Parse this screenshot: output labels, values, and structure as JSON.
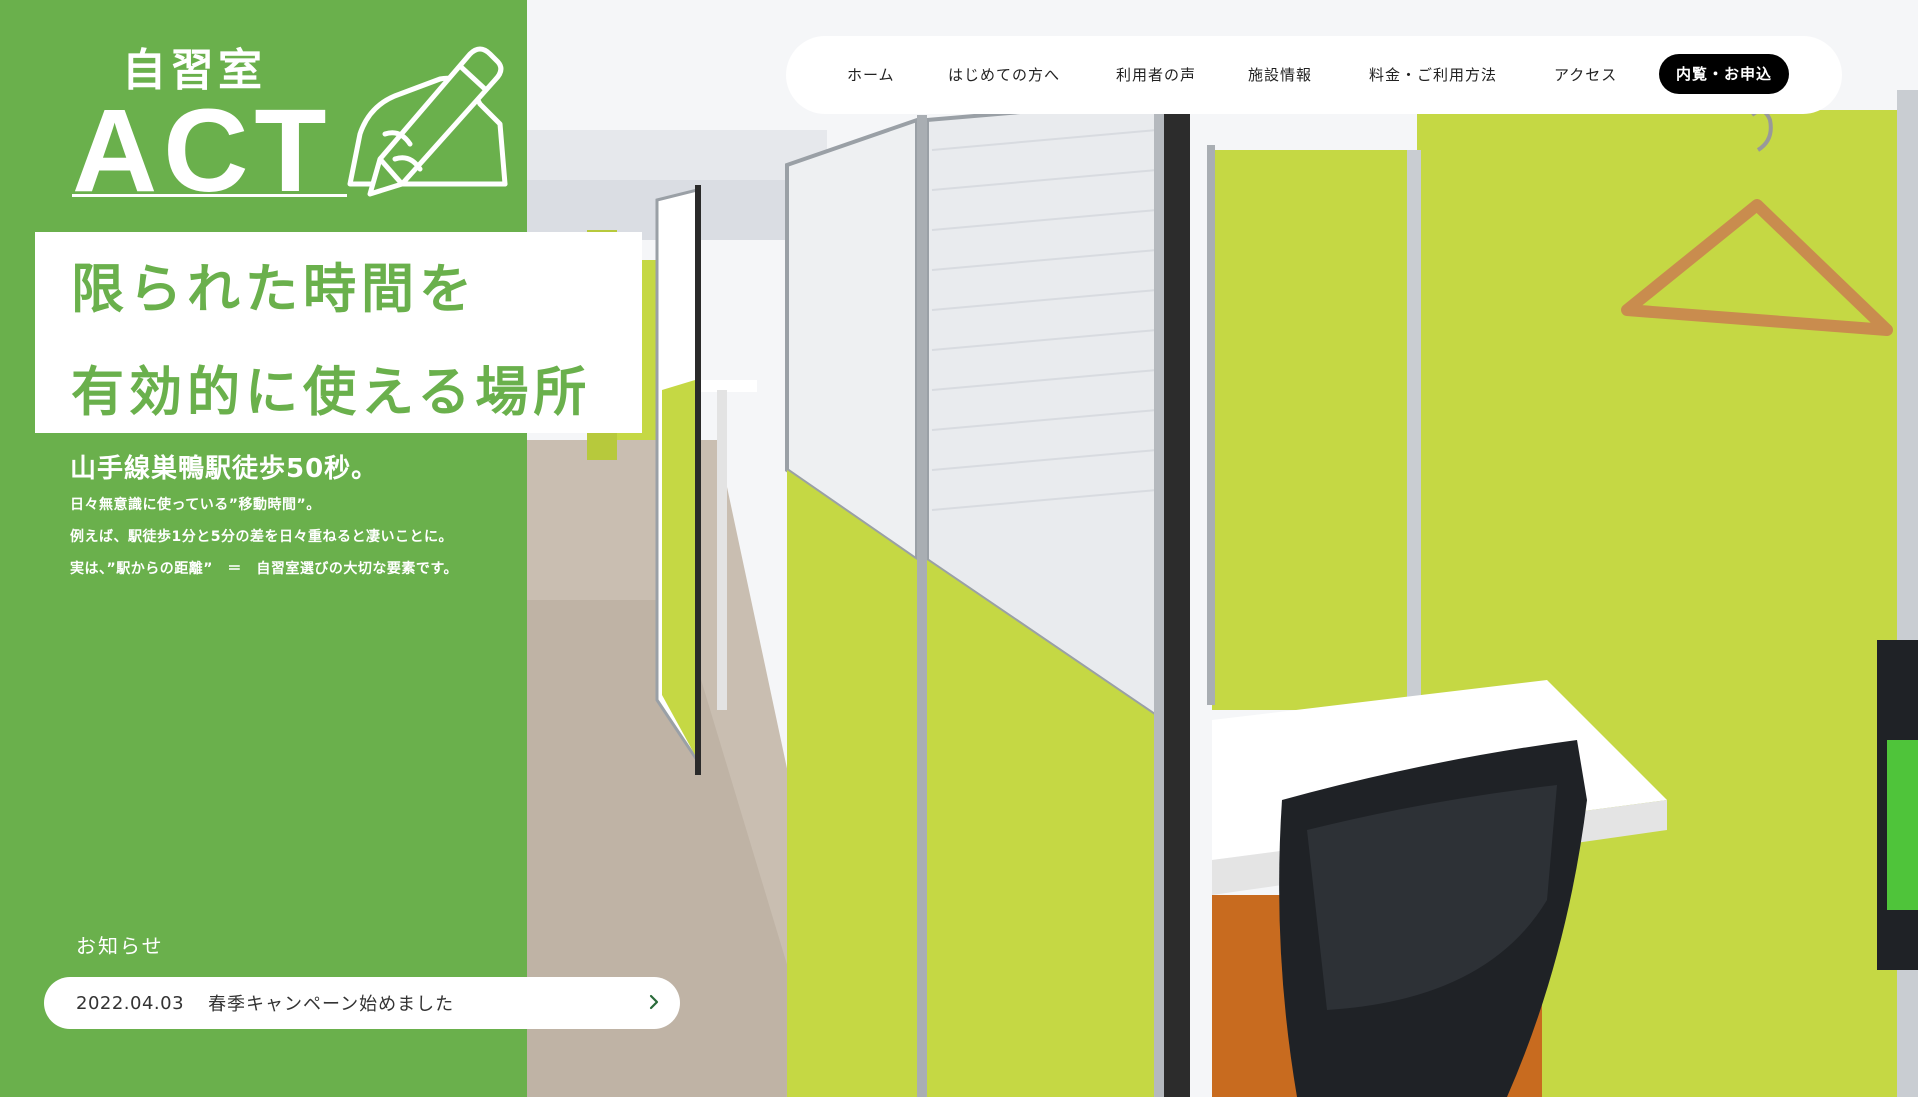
{
  "brand": {
    "sub": "自習室",
    "name": "ACT"
  },
  "nav": {
    "items": [
      "ホーム",
      "はじめての方へ",
      "利用者の声",
      "施設情報",
      "料金・ご利用方法",
      "アクセス"
    ],
    "cta": "内覧・お申込"
  },
  "hero": {
    "headline_1": "限られた時間を",
    "headline_2": "有効的に使える場所",
    "lead": "山手線巣鴨駅徒歩50秒。",
    "desc": [
      "日々無意識に使っている”移動時間”。",
      "例えば、駅徒歩1分と5分の差を日々重ねると凄いことに。",
      "実は、”駅からの距離”　＝　自習室選びの大切な要素です。"
    ]
  },
  "news": {
    "title": "お知らせ",
    "items": [
      {
        "date": "2022.04.03",
        "text": "春季キャンペーン始めました"
      }
    ]
  },
  "colors": {
    "brand_green": "#6ab04c",
    "booth_green": "#c5d844",
    "cta_black": "#000000"
  },
  "icons": {
    "logo_mark": "pencil-hand-icon",
    "news_arrow": "chevron-right-icon"
  }
}
